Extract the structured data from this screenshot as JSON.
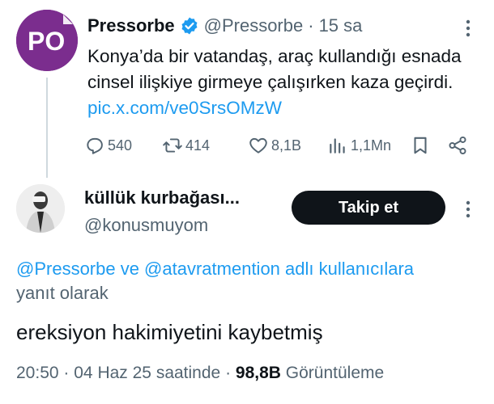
{
  "parent_tweet": {
    "name": "Pressorbe",
    "handle": "@Pressorbe",
    "separator": "·",
    "time": "15 sa",
    "text": "Konya’da bir vatandaş, araç kullandığı esnada cinsel ilişkiye girmeye çalışırken kaza geçirdi.",
    "link": "pic.x.com/ve0SrsOMzW",
    "avatar_letters": "PO",
    "avatar_color": "#7b2d8e",
    "actions": {
      "replies": "540",
      "reposts": "414",
      "likes": "8,1B",
      "views": "1,1Mn"
    }
  },
  "reply": {
    "name": "küllük kurbağası...",
    "handle": "@konusmuyom",
    "follow_label": "Takip et",
    "replying_to_users": "@Pressorbe ve @atavratmention",
    "replying_to_suffix": "adlı kullanıcılara",
    "replying_to_tail": "yanıt olarak",
    "text": "ereksiyon hakimiyetini kaybetmiş",
    "time": "20:50",
    "separator": "·",
    "date": "04 Haz 25 saatinde",
    "views_count": "98,8B",
    "views_label": "Görüntüleme"
  },
  "colors": {
    "link": "#1d9bf0",
    "secondary_text": "#536471",
    "primary_text": "#0f1419",
    "button_bg": "#0f1419"
  }
}
